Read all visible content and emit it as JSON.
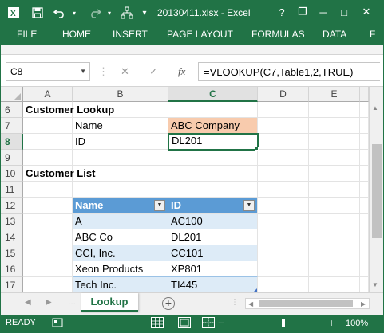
{
  "window": {
    "title": "20130411.xlsx - Excel",
    "controls": {
      "help": "?",
      "restore": "❐",
      "minimize": "─",
      "maximize": "□",
      "close": "✕"
    }
  },
  "quick_access": {
    "save_icon": "save-icon",
    "undo_icon": "undo-icon",
    "redo_icon": "redo-icon",
    "extra_icon": "diagram-icon"
  },
  "ribbon": {
    "tabs": [
      "FILE",
      "HOME",
      "INSERT",
      "PAGE LAYOUT",
      "FORMULAS",
      "DATA",
      "F"
    ]
  },
  "formula_bar": {
    "name_box": "C8",
    "cancel": "✕",
    "enter": "✓",
    "fx": "fx",
    "formula": "=VLOOKUP(C7,Table1,2,TRUE)"
  },
  "grid": {
    "columns": [
      "A",
      "B",
      "C",
      "D",
      "E"
    ],
    "selected_column": "C",
    "rows": [
      "6",
      "7",
      "8",
      "9",
      "10",
      "11",
      "12",
      "13",
      "14",
      "15",
      "16",
      "17"
    ],
    "selected_row": "8",
    "cells": {
      "a6": "Customer Lookup",
      "b7": "Name",
      "c7": "ABC Company",
      "b8": "ID",
      "c8": "DL201",
      "a10": "Customer List",
      "b12": "Name",
      "c12": "ID",
      "b13": "A",
      "c13": "AC100",
      "b14": "ABC Co",
      "c14": "DL201",
      "b15": "CCI, Inc.",
      "c15": "CC101",
      "b16": "Xeon Products",
      "c16": "XP801",
      "b17": "Tech Inc.",
      "c17": "TI445"
    },
    "colors": {
      "lookup_highlight": "#f8cbad",
      "table_header": "#5b9bd5",
      "table_band": "#ddebf7",
      "selection": "#217346"
    }
  },
  "sheets": {
    "active": "Lookup",
    "add_label": "+"
  },
  "status": {
    "ready": "READY",
    "zoom": "100%",
    "zoom_minus": "−",
    "zoom_plus": "+"
  }
}
